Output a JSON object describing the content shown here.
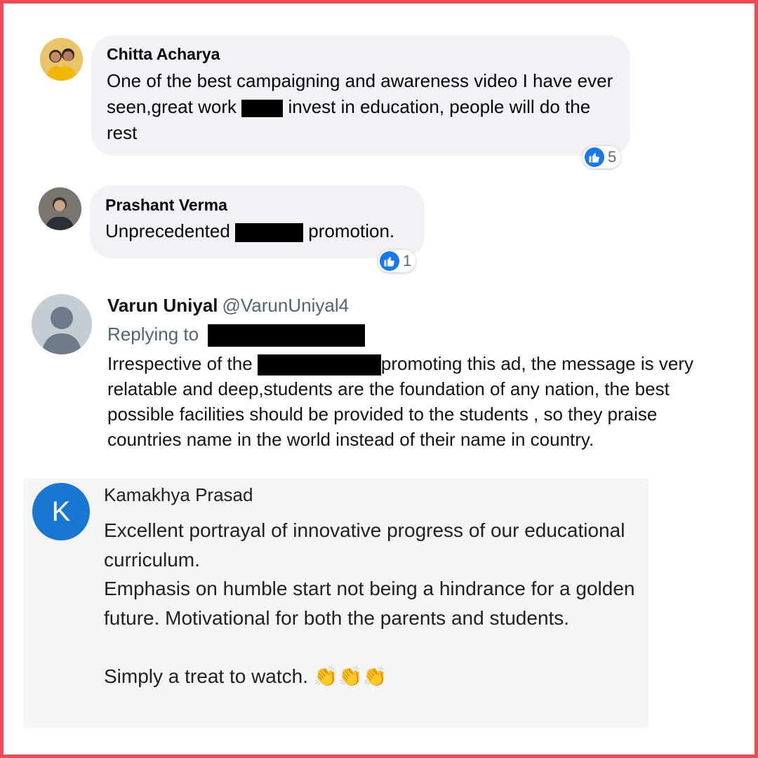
{
  "comments": [
    {
      "author": "Chitta Acharya",
      "text_before_redaction": "One of the best campaigning and awareness video I have ever seen,great work",
      "text_after_redaction": "invest in education, people will do the rest",
      "reaction_icon": "like-icon",
      "reaction_count": "5"
    },
    {
      "author": "Prashant Verma",
      "text_before_redaction": "Unprecedented",
      "text_after_redaction": "promotion.",
      "reaction_icon": "like-icon",
      "reaction_count": "1"
    }
  ],
  "tweet": {
    "author": "Varun Uniyal",
    "handle": "@VarunUniyal4",
    "replying_to_label": "Replying to",
    "text_before_redaction": "Irrespective of the",
    "text_after_redaction": "promoting this ad, the message is very relatable and deep,students are the foundation of any nation, the best possible facilities should be provided to the students , so they praise countries name in the world instead of their name in country."
  },
  "google_comment": {
    "avatar_initial": "K",
    "author": "Kamakhya Prasad",
    "paragraph_1": "Excellent portrayal of innovative progress of our educational curriculum.",
    "paragraph_2": "Emphasis on humble start not being a hindrance for a golden future. Motivational for both the parents and students.",
    "paragraph_3": "Simply a treat to watch.",
    "emoji": "👏👏👏"
  },
  "colors": {
    "frame_border": "#ef4a55",
    "bubble_bg": "#f0f2f5",
    "like_blue": "#1877f2",
    "google_avatar": "#1976d2",
    "panel_bg": "#f5f5f5"
  }
}
